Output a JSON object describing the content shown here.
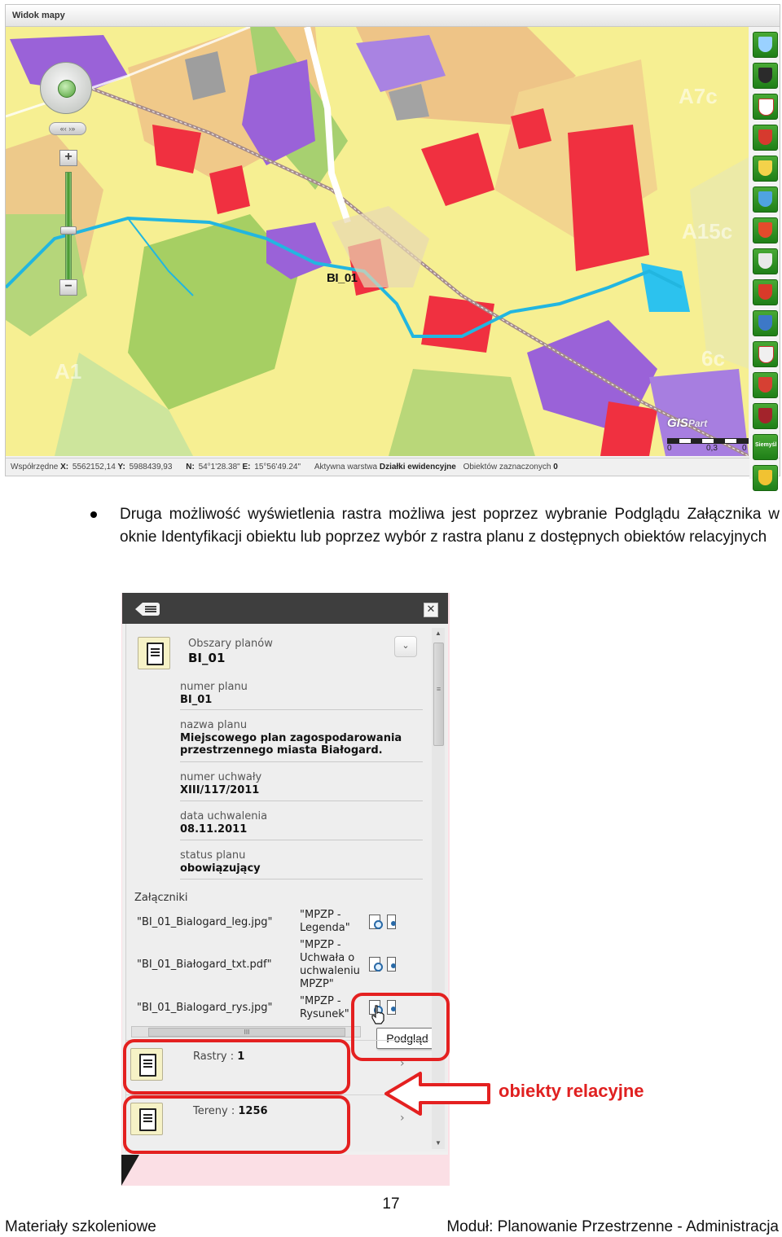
{
  "map": {
    "title": "Widok mapy",
    "plan_label": "BI_01",
    "faint_labels": [
      "A7c",
      "A15c",
      "A1",
      "6c"
    ],
    "nav_pan": "«‹ ›»",
    "zoom_in": "+",
    "zoom_out": "−",
    "logo": "GIS",
    "logo_suffix": "Part",
    "scale_left": "0",
    "scale_mid": "0,3",
    "scale_right": "0",
    "status": {
      "coords_label": "Współrzędne",
      "x_label": "X:",
      "x_value": "5562152,14",
      "y_label": "Y:",
      "y_value": "5988439,93",
      "n_label": "N:",
      "n_value": "54°1'28.38\"",
      "e_label": "E:",
      "e_value": "15°56'49.24\"",
      "layer_label": "Aktywna warstwa",
      "layer_value": "Działki ewidencyjne",
      "selected_label": "Obiektów zaznaczonych",
      "selected_value": "0"
    },
    "crest_text": "Siemyśl"
  },
  "bullet": {
    "text": "Druga możliwość wyświetlenia rastra możliwa jest poprzez wybranie Podglądu Załącznika w oknie Identyfikacji obiektu lub poprzez wybór z rastra planu z dostępnych obiektów relacyjnych"
  },
  "panel": {
    "close": "✕",
    "layer": "Obszary planów",
    "layer_value": "BI_01",
    "dropdown": "⌄",
    "fields": [
      {
        "label": "numer planu",
        "value": "BI_01"
      },
      {
        "label": "nazwa planu",
        "value": "Miejscowego plan zagospodarowania przestrzennego miasta Białogard."
      },
      {
        "label": "numer uchwały",
        "value": "XIII/117/2011"
      },
      {
        "label": "data uchwalenia",
        "value": "08.11.2011"
      },
      {
        "label": "status planu",
        "value": "obowiązujący"
      }
    ],
    "attachments_title": "Załączniki",
    "attachments": [
      {
        "file": "\"BI_01_Bialogard_leg.jpg\"",
        "desc": "\"MPZP - Legenda\""
      },
      {
        "file": "\"BI_01_Białogard_txt.pdf\"",
        "desc": "\"MPZP - Uchwała o uchwaleniu MPZP\""
      },
      {
        "file": "\"BI_01_Bialogard_rys.jpg\"",
        "desc": "\"MPZP - Rysunek\""
      }
    ],
    "tooltip": "Podgląd",
    "relations": [
      {
        "label": "Rastry",
        "sep": " : ",
        "value": "1"
      },
      {
        "label": "Tereny",
        "sep": " : ",
        "value": "1256"
      }
    ],
    "chevron": "›",
    "scroll_grip": "≡",
    "hscroll_grip": "III"
  },
  "annotation": "obiekty relacyjne",
  "footer": {
    "page_number": "17",
    "left": "Materiały szkoleniowe",
    "right": "Moduł: Planowanie Przestrzenne - Administracja"
  },
  "colors": {
    "annotation_red": "#e42020",
    "crest_green": "#2f9425",
    "map_yellow": "#f6ef92",
    "map_red": "#f03040",
    "map_purple": "#9a62d8",
    "map_green": "#9acb63",
    "river_cyan": "#22b6e0"
  }
}
